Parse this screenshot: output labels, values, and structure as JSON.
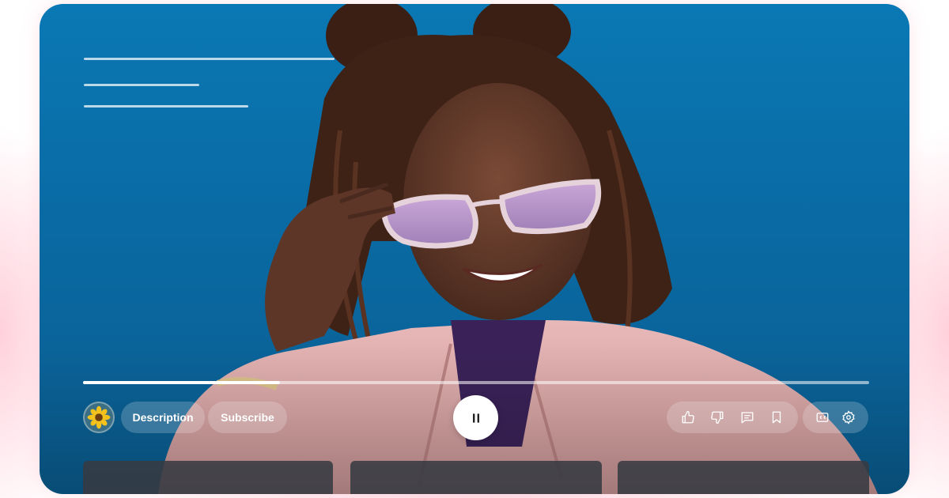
{
  "player": {
    "progress": 0.25,
    "avatar_icon": "sunflower-icon",
    "description_label": "Description",
    "subscribe_label": "Subscribe",
    "play_state_icon": "pause-icon",
    "actions": [
      "thumbs-up-icon",
      "thumbs-down-icon",
      "comment-icon",
      "bookmark-icon",
      "closed-captions-icon",
      "settings-gear-icon"
    ]
  },
  "colors": {
    "background_blue": "#0a6aa3",
    "glow_pink": "#ffaabe",
    "control_white": "#ffffff"
  }
}
